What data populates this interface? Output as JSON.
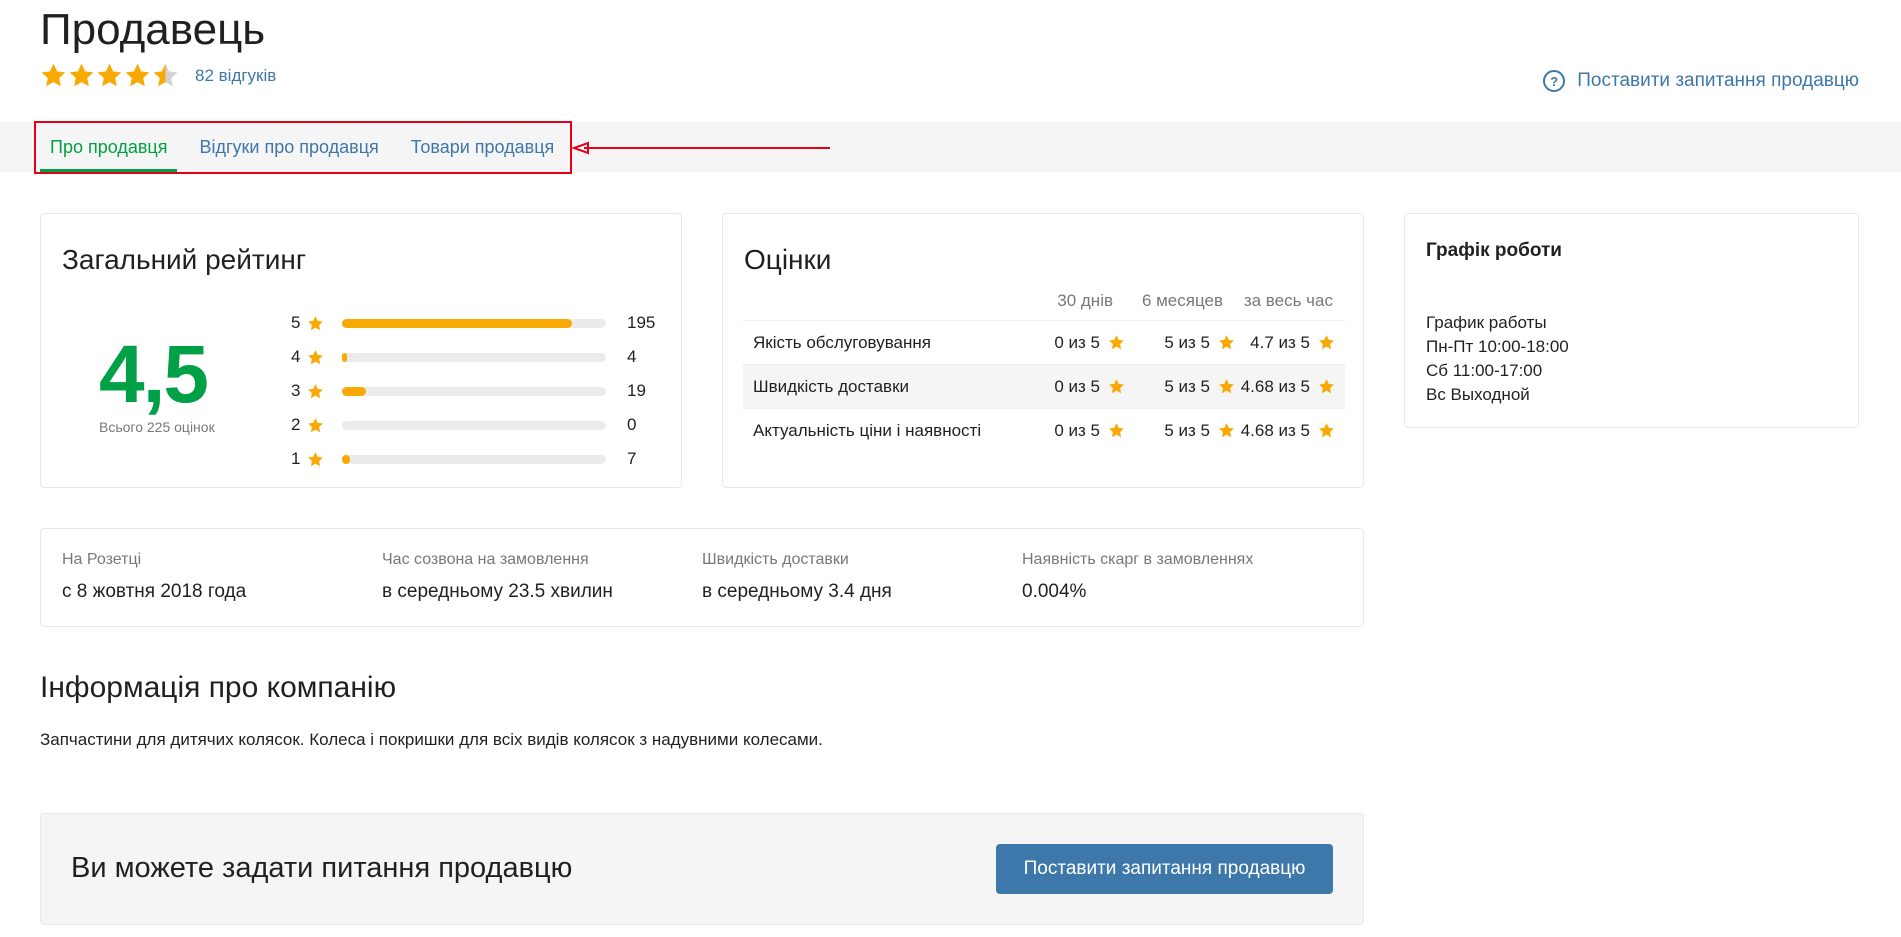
{
  "header": {
    "title": "Продавець",
    "rating_value": 4.5,
    "rating_max": 5,
    "reviews_link": "82 відгуків",
    "ask_link": "Поставити запитання продавцю"
  },
  "tabs": [
    {
      "label": "Про продавця",
      "active": true
    },
    {
      "label": "Відгуки про продавця",
      "active": false
    },
    {
      "label": "Товари продавця",
      "active": false
    }
  ],
  "overall_rating": {
    "title": "Загальний рейтинг",
    "score": "4,5",
    "total": "Всього 225 оцінок",
    "bars": [
      {
        "stars": "5",
        "count": "195",
        "fraction": 0.87
      },
      {
        "stars": "4",
        "count": "4",
        "fraction": 0.02
      },
      {
        "stars": "3",
        "count": "19",
        "fraction": 0.09
      },
      {
        "stars": "2",
        "count": "0",
        "fraction": 0.0
      },
      {
        "stars": "1",
        "count": "7",
        "fraction": 0.03
      }
    ]
  },
  "scores": {
    "title": "Оцінки",
    "columns": [
      "30 днів",
      "6 месяцев",
      "за весь час"
    ],
    "rows": [
      {
        "label": "Якість обслуговування",
        "values": [
          "0 из 5",
          "5 из 5",
          "4.7 из 5"
        ]
      },
      {
        "label": "Швидкість доставки",
        "values": [
          "0 из 5",
          "5 из 5",
          "4.68 из 5"
        ]
      },
      {
        "label": "Актуальність ціни і наявності",
        "values": [
          "0 из 5",
          "5 из 5",
          "4.68 из 5"
        ]
      }
    ]
  },
  "schedule": {
    "title": "Графік роботи",
    "lines": [
      "График работы",
      "Пн-Пт 10:00-18:00",
      "Сб 11:00-17:00",
      "Вс Выходной"
    ]
  },
  "stats": [
    {
      "label": "На Розетці",
      "value": "с 8 жовтня 2018 года"
    },
    {
      "label": "Час созвона на замовлення",
      "value": "в середньому 23.5 хвилин"
    },
    {
      "label": "Швидкість доставки",
      "value": "в середньому 3.4 дня"
    },
    {
      "label": "Наявність скарг в замовленнях",
      "value": "0.004%"
    }
  ],
  "company": {
    "title": "Інформація про компанію",
    "description": "Запчастини для дитячих колясок. Колеса і покришки для всіх видів колясок з надувними колесами."
  },
  "ask_box": {
    "text": "Ви можете задати питання продавцю",
    "button": "Поставити запитання продавцю"
  },
  "colors": {
    "accent_green": "#00a046",
    "link_blue": "#3e77aa",
    "star_orange": "#f8a903",
    "highlight_red": "#e3001b"
  }
}
